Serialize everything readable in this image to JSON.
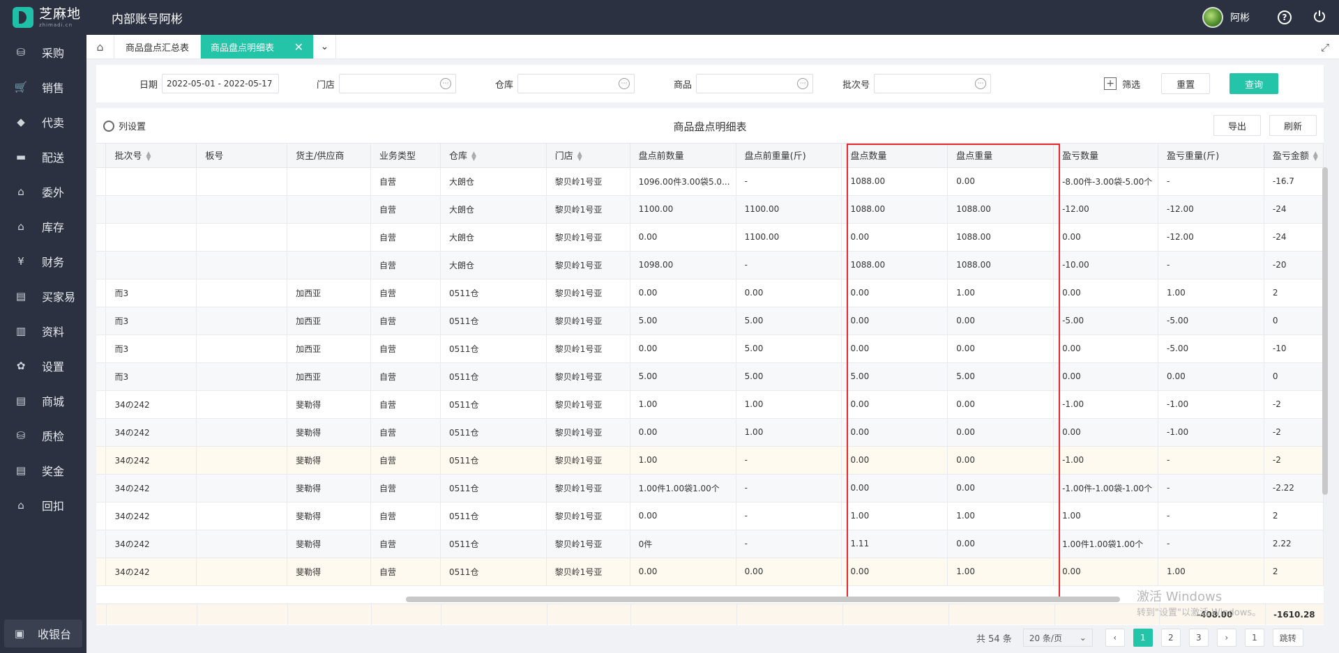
{
  "app": {
    "logo_cn": "芝麻地",
    "logo_en": "zhimadi.cn",
    "account_title": "内部账号阿彬",
    "username": "阿彬"
  },
  "sidebar": {
    "items": [
      {
        "label": "采购",
        "icon": "basket-icon"
      },
      {
        "label": "销售",
        "icon": "cart-icon"
      },
      {
        "label": "代卖",
        "icon": "tag-icon"
      },
      {
        "label": "配送",
        "icon": "truck-icon"
      },
      {
        "label": "委外",
        "icon": "building-icon"
      },
      {
        "label": "库存",
        "icon": "warehouse-icon"
      },
      {
        "label": "财务",
        "icon": "yen-shield-icon"
      },
      {
        "label": "买家易",
        "icon": "store-icon"
      },
      {
        "label": "资料",
        "icon": "printer-icon"
      },
      {
        "label": "设置",
        "icon": "gear-icon"
      },
      {
        "label": "商城",
        "icon": "store-icon"
      },
      {
        "label": "质检",
        "icon": "basket-icon"
      },
      {
        "label": "奖金",
        "icon": "store-icon"
      },
      {
        "label": "回扣",
        "icon": "building-icon"
      }
    ],
    "cashier": "收银台"
  },
  "tabs": {
    "items": [
      "商品盘点汇总表",
      "商品盘点明细表"
    ],
    "active_index": 1
  },
  "filter": {
    "date_label": "日期",
    "date_value": "2022-05-01 - 2022-05-17",
    "store_label": "门店",
    "warehouse_label": "仓库",
    "product_label": "商品",
    "batch_label": "批次号",
    "filter_label": "筛选",
    "reset_label": "重置",
    "query_label": "查询"
  },
  "table_card": {
    "column_settings": "列设置",
    "title": "商品盘点明细表",
    "export_label": "导出",
    "refresh_label": "刷新"
  },
  "table": {
    "columns": [
      "批次号",
      "板号",
      "货主/供应商",
      "业务类型",
      "仓库",
      "门店",
      "盘点前数量",
      "盘点前重量(斤)",
      "盘点数量",
      "盘点重量",
      "盈亏数量",
      "盈亏重量(斤)",
      "盈亏金额"
    ],
    "sortable": [
      true,
      false,
      false,
      false,
      true,
      true,
      false,
      false,
      false,
      false,
      false,
      false,
      true
    ],
    "rows": [
      [
        "",
        "",
        "",
        "自营",
        "大朗仓",
        "黎贝岭1号亚",
        "1096.00件3.00袋5.0...",
        "-",
        "1088.00",
        "0.00",
        "-8.00件-3.00袋-5.00个",
        "-",
        "-16.7"
      ],
      [
        "",
        "",
        "",
        "自营",
        "大朗仓",
        "黎贝岭1号亚",
        "1100.00",
        "1100.00",
        "1088.00",
        "1088.00",
        "-12.00",
        "-12.00",
        "-24"
      ],
      [
        "",
        "",
        "",
        "自营",
        "大朗仓",
        "黎贝岭1号亚",
        "0.00",
        "1100.00",
        "0.00",
        "1088.00",
        "0.00",
        "-12.00",
        "-24"
      ],
      [
        "",
        "",
        "",
        "自营",
        "大朗仓",
        "黎贝岭1号亚",
        "1098.00",
        "-",
        "1088.00",
        "1088.00",
        "-10.00",
        "-",
        "-20"
      ],
      [
        "而3",
        "",
        "加西亚",
        "自营",
        "0511仓",
        "黎贝岭1号亚",
        "0.00",
        "0.00",
        "0.00",
        "1.00",
        "0.00",
        "1.00",
        "2"
      ],
      [
        "而3",
        "",
        "加西亚",
        "自营",
        "0511仓",
        "黎贝岭1号亚",
        "5.00",
        "5.00",
        "0.00",
        "0.00",
        "-5.00",
        "-5.00",
        "0"
      ],
      [
        "而3",
        "",
        "加西亚",
        "自营",
        "0511仓",
        "黎贝岭1号亚",
        "0.00",
        "5.00",
        "0.00",
        "0.00",
        "0.00",
        "-5.00",
        "-10"
      ],
      [
        "而3",
        "",
        "加西亚",
        "自营",
        "0511仓",
        "黎贝岭1号亚",
        "5.00",
        "5.00",
        "5.00",
        "5.00",
        "0.00",
        "0.00",
        "0"
      ],
      [
        "34の242",
        "",
        "斐勒得",
        "自营",
        "0511仓",
        "黎贝岭1号亚",
        "1.00",
        "1.00",
        "0.00",
        "0.00",
        "-1.00",
        "-1.00",
        "-2"
      ],
      [
        "34の242",
        "",
        "斐勒得",
        "自营",
        "0511仓",
        "黎贝岭1号亚",
        "0.00",
        "1.00",
        "0.00",
        "0.00",
        "0.00",
        "-1.00",
        "-2"
      ],
      [
        "34の242",
        "",
        "斐勒得",
        "自营",
        "0511仓",
        "黎贝岭1号亚",
        "1.00",
        "-",
        "0.00",
        "0.00",
        "-1.00",
        "-",
        "-2"
      ],
      [
        "34の242",
        "",
        "斐勒得",
        "自营",
        "0511仓",
        "黎贝岭1号亚",
        "1.00件1.00袋1.00个",
        "-",
        "0.00",
        "0.00",
        "-1.00件-1.00袋-1.00个",
        "-",
        "-2.22"
      ],
      [
        "34の242",
        "",
        "斐勒得",
        "自营",
        "0511仓",
        "黎贝岭1号亚",
        "0.00",
        "-",
        "1.00",
        "1.00",
        "1.00",
        "-",
        "2"
      ],
      [
        "34の242",
        "",
        "斐勒得",
        "自营",
        "0511仓",
        "黎贝岭1号亚",
        "0件",
        "-",
        "1.11",
        "0.00",
        "1.00件1.00袋1.00个",
        "-",
        "2.22"
      ],
      [
        "34の242",
        "",
        "斐勒得",
        "自营",
        "0511仓",
        "黎贝岭1号亚",
        "0.00",
        "0.00",
        "0.00",
        "1.00",
        "0.00",
        "1.00",
        "2"
      ]
    ],
    "summary": {
      "profit_weight": "-408.00",
      "profit_amount": "-1610.28"
    }
  },
  "watermark": {
    "line1": "激活 Windows",
    "line2": "转到\"设置\"以激活 Windows。"
  },
  "pagination": {
    "total": "共 54 条",
    "page_size": "20 条/页",
    "pages": [
      "1",
      "2",
      "3"
    ],
    "current": "1",
    "jump_value": "1",
    "jump_label": "跳转"
  },
  "colors": {
    "accent": "#23c4a8",
    "sidebar": "#2b3140",
    "highlight_border": "#e8262b"
  }
}
